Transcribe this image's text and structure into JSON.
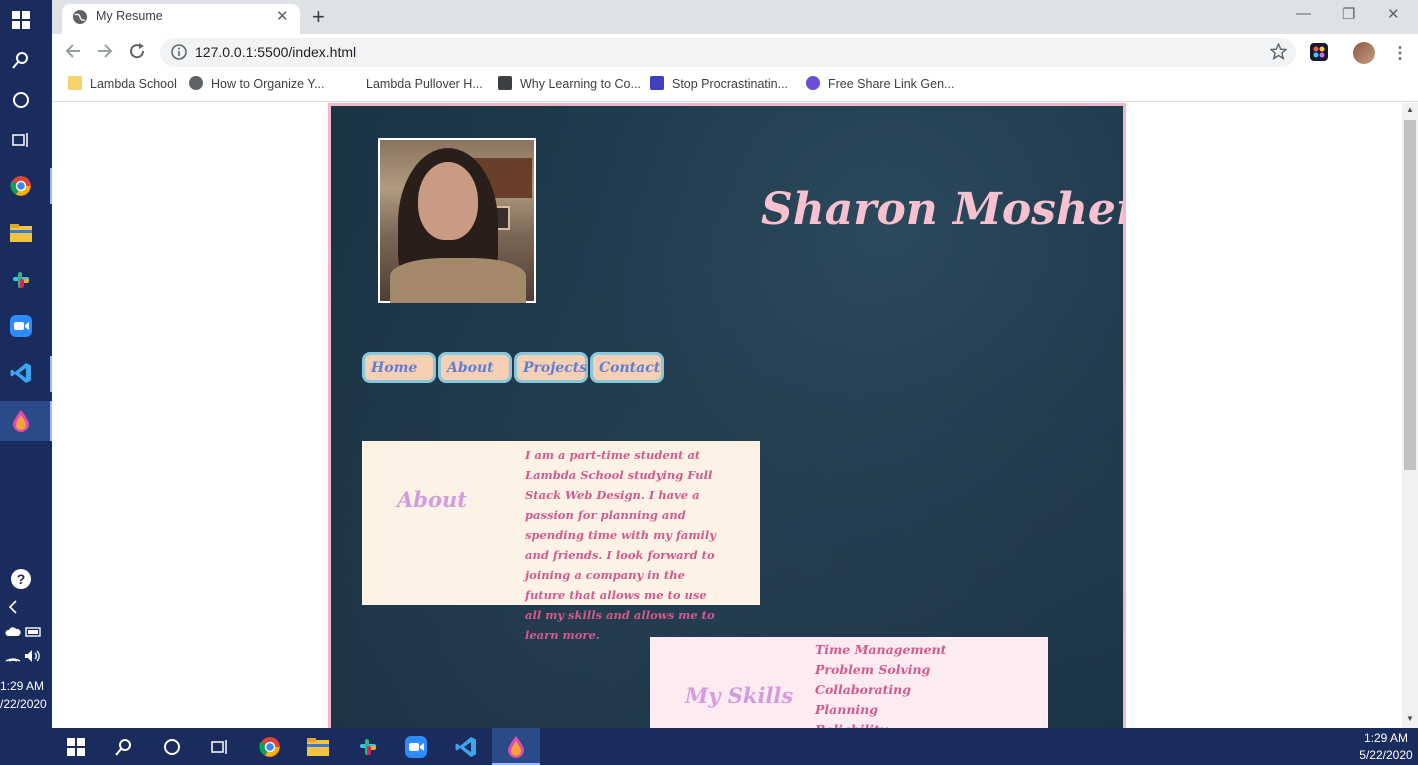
{
  "browser": {
    "tab_title": "My Resume",
    "url": "127.0.0.1:5500/index.html",
    "bookmarks": [
      {
        "label": "Lambda School",
        "icon": "folder-icon"
      },
      {
        "label": "How to Organize Y...",
        "icon": "globe-icon"
      },
      {
        "label": "Lambda Pullover H...",
        "icon": "lambda-icon"
      },
      {
        "label": "Why Learning to Co...",
        "icon": "doc-icon"
      },
      {
        "label": "Stop Procrastinatin...",
        "icon": "video-icon"
      },
      {
        "label": "Free Share Link Gen...",
        "icon": "link-icon"
      }
    ]
  },
  "resume": {
    "name": "Sharon Mosher",
    "nav": [
      "Home",
      "About",
      "Projects",
      "Contact"
    ],
    "about": {
      "title": "About",
      "text": "I am a part-time student at Lambda School studying Full Stack Web Design. I have a passion for planning and spending time with my family and friends. I look forward to joining a company in the future that allows me to use all my skills and allows me to learn more."
    },
    "skills": {
      "title": "My Skills",
      "items": [
        "Time Management",
        "Problem Solving",
        "Collaborating",
        "Planning",
        "Reliability"
      ]
    }
  },
  "system": {
    "sidebar_time": "1:29 AM",
    "sidebar_date": "/22/2020",
    "clock_time": "1:29 AM",
    "clock_date": "5/22/2020"
  },
  "colors": {
    "page_border": "#f6b6c8",
    "name": "#f8c1cf",
    "nav_fill": "#f7d0b4",
    "nav_border": "#87c8df",
    "card_text": "#d25a8e",
    "card_title": "#d39ce0"
  }
}
